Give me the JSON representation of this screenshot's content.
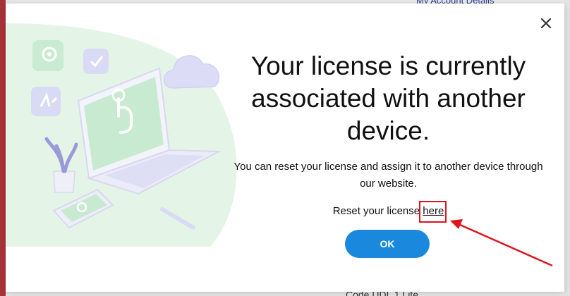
{
  "background": {
    "top_text": "My Account Details",
    "bottom_text": "Code UDL 1 Lite"
  },
  "dialog": {
    "close_icon": "close-icon",
    "title": "Your license is currently associated with another device.",
    "description": "You can reset your license and assign it to another device through our website.",
    "reset_prefix": "Reset your license ",
    "reset_link": "here",
    "ok_label": "OK"
  },
  "colors": {
    "accent": "#1a88dd",
    "highlight": "#e0141e",
    "illustration_green": "#c7ead0",
    "illustration_lavender": "#d9daf4"
  }
}
